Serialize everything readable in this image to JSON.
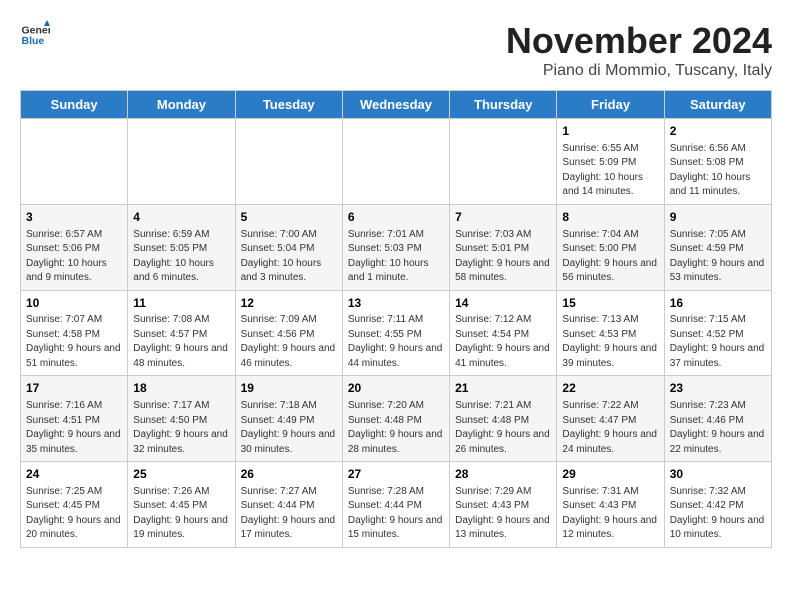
{
  "header": {
    "logo_general": "General",
    "logo_blue": "Blue",
    "month": "November 2024",
    "location": "Piano di Mommio, Tuscany, Italy"
  },
  "days_of_week": [
    "Sunday",
    "Monday",
    "Tuesday",
    "Wednesday",
    "Thursday",
    "Friday",
    "Saturday"
  ],
  "weeks": [
    [
      {
        "day": "",
        "info": ""
      },
      {
        "day": "",
        "info": ""
      },
      {
        "day": "",
        "info": ""
      },
      {
        "day": "",
        "info": ""
      },
      {
        "day": "",
        "info": ""
      },
      {
        "day": "1",
        "info": "Sunrise: 6:55 AM\nSunset: 5:09 PM\nDaylight: 10 hours and 14 minutes."
      },
      {
        "day": "2",
        "info": "Sunrise: 6:56 AM\nSunset: 5:08 PM\nDaylight: 10 hours and 11 minutes."
      }
    ],
    [
      {
        "day": "3",
        "info": "Sunrise: 6:57 AM\nSunset: 5:06 PM\nDaylight: 10 hours and 9 minutes."
      },
      {
        "day": "4",
        "info": "Sunrise: 6:59 AM\nSunset: 5:05 PM\nDaylight: 10 hours and 6 minutes."
      },
      {
        "day": "5",
        "info": "Sunrise: 7:00 AM\nSunset: 5:04 PM\nDaylight: 10 hours and 3 minutes."
      },
      {
        "day": "6",
        "info": "Sunrise: 7:01 AM\nSunset: 5:03 PM\nDaylight: 10 hours and 1 minute."
      },
      {
        "day": "7",
        "info": "Sunrise: 7:03 AM\nSunset: 5:01 PM\nDaylight: 9 hours and 58 minutes."
      },
      {
        "day": "8",
        "info": "Sunrise: 7:04 AM\nSunset: 5:00 PM\nDaylight: 9 hours and 56 minutes."
      },
      {
        "day": "9",
        "info": "Sunrise: 7:05 AM\nSunset: 4:59 PM\nDaylight: 9 hours and 53 minutes."
      }
    ],
    [
      {
        "day": "10",
        "info": "Sunrise: 7:07 AM\nSunset: 4:58 PM\nDaylight: 9 hours and 51 minutes."
      },
      {
        "day": "11",
        "info": "Sunrise: 7:08 AM\nSunset: 4:57 PM\nDaylight: 9 hours and 48 minutes."
      },
      {
        "day": "12",
        "info": "Sunrise: 7:09 AM\nSunset: 4:56 PM\nDaylight: 9 hours and 46 minutes."
      },
      {
        "day": "13",
        "info": "Sunrise: 7:11 AM\nSunset: 4:55 PM\nDaylight: 9 hours and 44 minutes."
      },
      {
        "day": "14",
        "info": "Sunrise: 7:12 AM\nSunset: 4:54 PM\nDaylight: 9 hours and 41 minutes."
      },
      {
        "day": "15",
        "info": "Sunrise: 7:13 AM\nSunset: 4:53 PM\nDaylight: 9 hours and 39 minutes."
      },
      {
        "day": "16",
        "info": "Sunrise: 7:15 AM\nSunset: 4:52 PM\nDaylight: 9 hours and 37 minutes."
      }
    ],
    [
      {
        "day": "17",
        "info": "Sunrise: 7:16 AM\nSunset: 4:51 PM\nDaylight: 9 hours and 35 minutes."
      },
      {
        "day": "18",
        "info": "Sunrise: 7:17 AM\nSunset: 4:50 PM\nDaylight: 9 hours and 32 minutes."
      },
      {
        "day": "19",
        "info": "Sunrise: 7:18 AM\nSunset: 4:49 PM\nDaylight: 9 hours and 30 minutes."
      },
      {
        "day": "20",
        "info": "Sunrise: 7:20 AM\nSunset: 4:48 PM\nDaylight: 9 hours and 28 minutes."
      },
      {
        "day": "21",
        "info": "Sunrise: 7:21 AM\nSunset: 4:48 PM\nDaylight: 9 hours and 26 minutes."
      },
      {
        "day": "22",
        "info": "Sunrise: 7:22 AM\nSunset: 4:47 PM\nDaylight: 9 hours and 24 minutes."
      },
      {
        "day": "23",
        "info": "Sunrise: 7:23 AM\nSunset: 4:46 PM\nDaylight: 9 hours and 22 minutes."
      }
    ],
    [
      {
        "day": "24",
        "info": "Sunrise: 7:25 AM\nSunset: 4:45 PM\nDaylight: 9 hours and 20 minutes."
      },
      {
        "day": "25",
        "info": "Sunrise: 7:26 AM\nSunset: 4:45 PM\nDaylight: 9 hours and 19 minutes."
      },
      {
        "day": "26",
        "info": "Sunrise: 7:27 AM\nSunset: 4:44 PM\nDaylight: 9 hours and 17 minutes."
      },
      {
        "day": "27",
        "info": "Sunrise: 7:28 AM\nSunset: 4:44 PM\nDaylight: 9 hours and 15 minutes."
      },
      {
        "day": "28",
        "info": "Sunrise: 7:29 AM\nSunset: 4:43 PM\nDaylight: 9 hours and 13 minutes."
      },
      {
        "day": "29",
        "info": "Sunrise: 7:31 AM\nSunset: 4:43 PM\nDaylight: 9 hours and 12 minutes."
      },
      {
        "day": "30",
        "info": "Sunrise: 7:32 AM\nSunset: 4:42 PM\nDaylight: 9 hours and 10 minutes."
      }
    ]
  ]
}
